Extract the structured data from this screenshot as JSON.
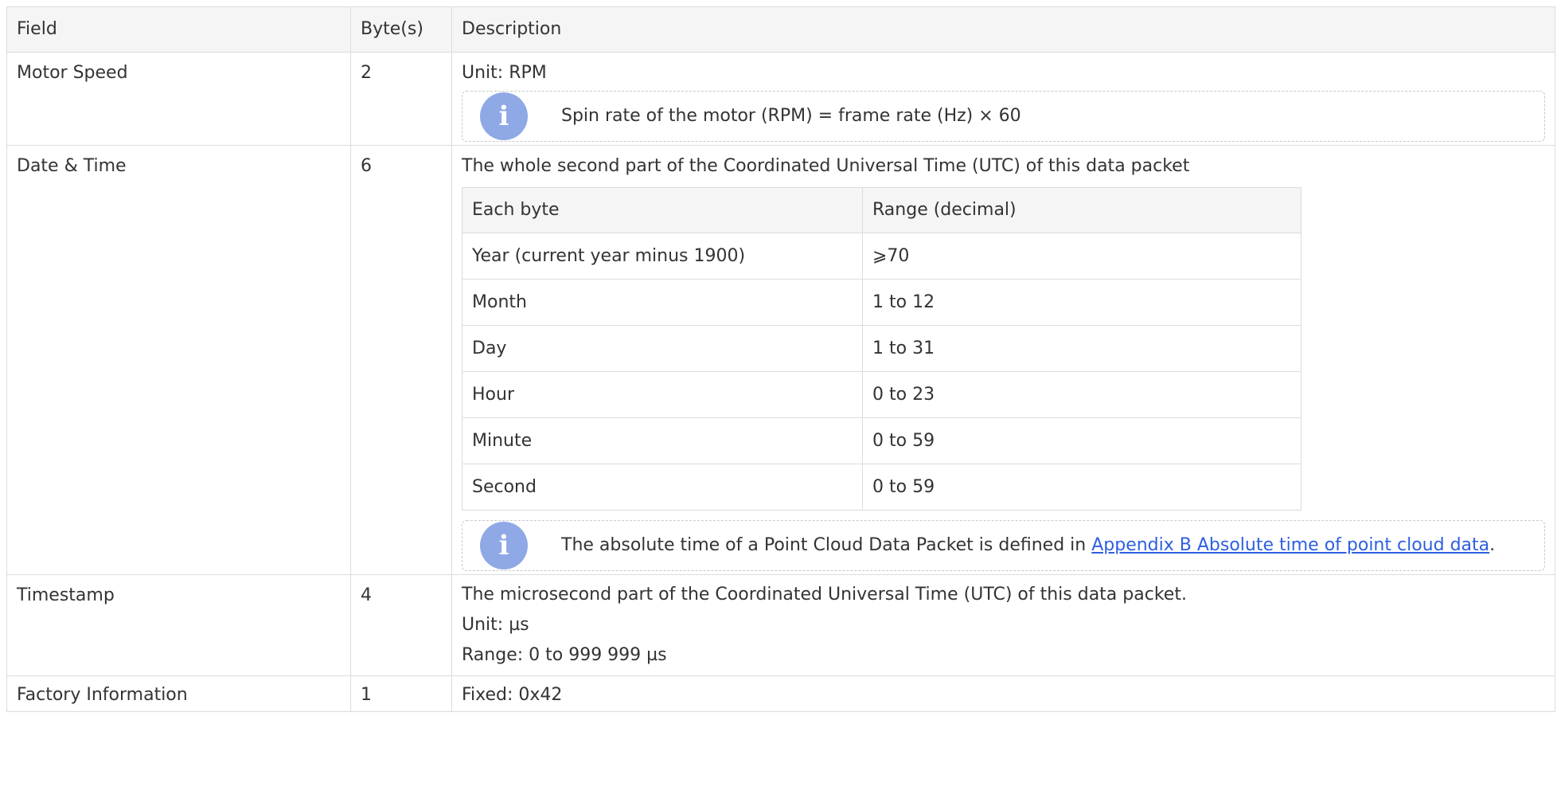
{
  "headers": {
    "field": "Field",
    "bytes": "Byte(s)",
    "description": "Description"
  },
  "rows": [
    {
      "field": "Motor Speed",
      "bytes": "2",
      "lines": [
        "Unit: RPM"
      ],
      "note": "Spin rate of the motor (RPM) = frame rate (Hz) × 60"
    },
    {
      "field": "Date & Time",
      "bytes": "6",
      "lines": [
        "The whole second part of the Coordinated Universal Time (UTC) of this data packet"
      ],
      "subtable": {
        "headers": [
          "Each byte",
          "Range (decimal)"
        ],
        "rows": [
          [
            "Year (current year minus 1900)",
            "⩾70"
          ],
          [
            "Month",
            "1 to 12"
          ],
          [
            "Day",
            "1 to 31"
          ],
          [
            "Hour",
            "0 to 23"
          ],
          [
            "Minute",
            "0 to 59"
          ],
          [
            "Second",
            "0 to 59"
          ]
        ]
      },
      "note_prefix": "The absolute time of a Point Cloud Data Packet is defined in ",
      "note_link": "Appendix B Absolute time of point cloud data",
      "note_suffix": "."
    },
    {
      "field": "Timestamp",
      "bytes": "4",
      "lines": [
        "The microsecond part of the Coordinated Universal Time (UTC) of this data packet.",
        "Unit: µs",
        "Range: 0 to 999 999 µs"
      ]
    },
    {
      "field": "Factory Information",
      "bytes": "1",
      "lines": [
        "Fixed: 0x42"
      ]
    }
  ],
  "icons": {
    "note": "info-icon"
  },
  "colors": {
    "header_bg": "#f5f5f5",
    "border": "#dcdcdc",
    "link": "#2d5fe0",
    "info_icon": "#8fa8e6"
  }
}
